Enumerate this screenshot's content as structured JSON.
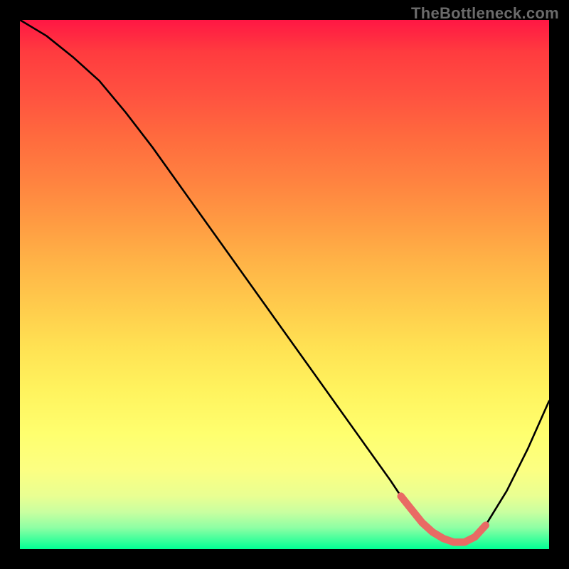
{
  "watermark": "TheBottleneck.com",
  "chart_data": {
    "type": "line",
    "title": "",
    "xlabel": "",
    "ylabel": "",
    "ylim": [
      0,
      100
    ],
    "x": [
      0,
      5,
      10,
      15,
      20,
      25,
      30,
      35,
      40,
      45,
      50,
      55,
      60,
      65,
      70,
      72,
      74,
      76,
      78,
      80,
      82,
      84,
      86,
      88,
      92,
      96,
      100
    ],
    "series": [
      {
        "name": "bottleneck-curve",
        "values": [
          100,
          97,
          93,
          88.5,
          82.5,
          76,
          69,
          62,
          55,
          48,
          41,
          34,
          27,
          20,
          13,
          10,
          7.5,
          5,
          3.2,
          2,
          1.3,
          1.3,
          2.3,
          4.5,
          11,
          19,
          28
        ]
      },
      {
        "name": "optimal-band",
        "values_x": [
          72,
          74,
          76,
          78,
          80,
          82,
          84,
          86,
          88
        ],
        "values_y": [
          10,
          7.5,
          5,
          3.2,
          2,
          1.3,
          1.3,
          2.3,
          4.5
        ]
      }
    ]
  }
}
